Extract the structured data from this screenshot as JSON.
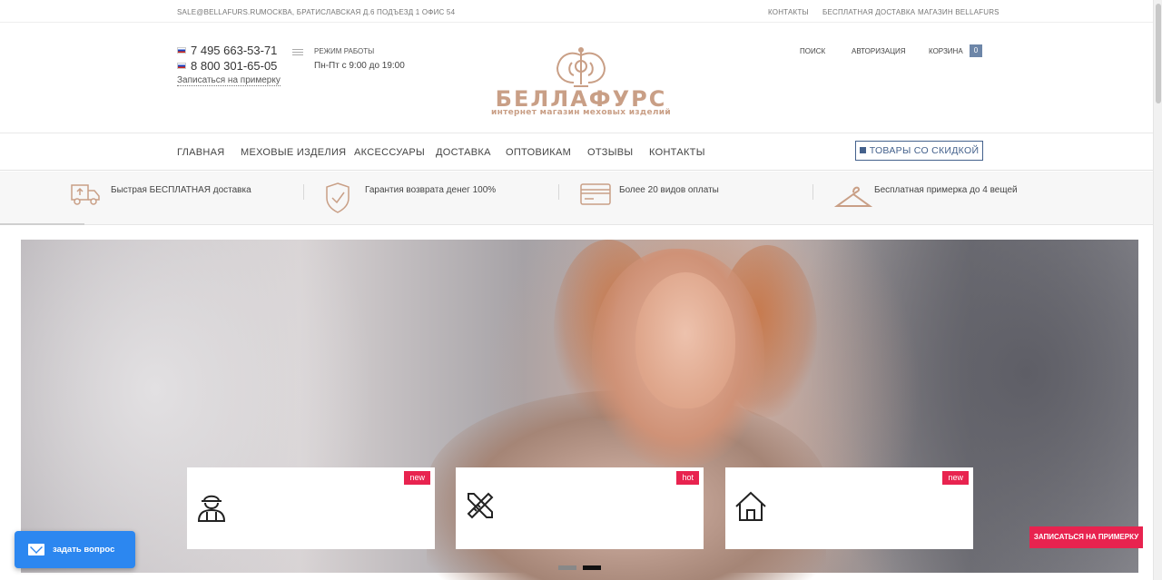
{
  "topbar": {
    "email": "SALE@BELLAFURS.RU",
    "address": "МОСКВА, БРАТИСЛАВСКАЯ Д.6 ПОДЪЕЗД 1 ОФИС 54",
    "links": [
      "КОНТАКТЫ",
      "БЕСПЛАТНАЯ ДОСТАВКА",
      "МАГАЗИН BELLAFURS"
    ]
  },
  "header": {
    "phones": [
      "7 495 663-53-71",
      "8 800 301-65-05"
    ],
    "fitting_link": "Записаться на примерку",
    "hours_title": "РЕЖИМ РАБОТЫ",
    "hours_value": "Пн-Пт с 9:00 до 19:00",
    "logo_title": "БЕЛЛАФУРС",
    "logo_subtitle": "интернет магазин меховых изделий",
    "search": "ПОИСК",
    "auth": "АВТОРИЗАЦИЯ",
    "cart": "КОРЗИНА",
    "cart_count": "0"
  },
  "nav": {
    "items": [
      "ГЛАВНАЯ",
      "МЕХОВЫЕ ИЗДЕЛИЯ",
      "АКСЕССУАРЫ",
      "ДОСТАВКА",
      "ОПТОВИКАМ",
      "ОТЗЫВЫ",
      "КОНТАКТЫ"
    ],
    "discount_button": "ТОВАРЫ СО СКИДКОЙ"
  },
  "features": [
    {
      "icon": "truck-icon",
      "text": "Быстрая БЕСПЛАТНАЯ доставка"
    },
    {
      "icon": "shield-check-icon",
      "text": "Гарантия возврата денег 100%"
    },
    {
      "icon": "credit-card-icon",
      "text": "Более 20 видов оплаты"
    },
    {
      "icon": "hanger-icon",
      "text": "Бесплатная примерка до 4 вещей"
    }
  ],
  "cards": [
    {
      "badge": "new",
      "icon": "worker-icon"
    },
    {
      "badge": "hot",
      "icon": "pencil-ruler-icon"
    },
    {
      "badge": "new",
      "icon": "home-icon"
    }
  ],
  "ask_button": "задать вопрос",
  "fitting_button": "ЗАПИСАТЬСЯ НА ПРИМЕРКУ",
  "colors": {
    "accent_blue": "#44618c",
    "brand_gold": "#c99f86",
    "badge_red": "#e8234f",
    "chat_blue": "#2c87f0"
  }
}
